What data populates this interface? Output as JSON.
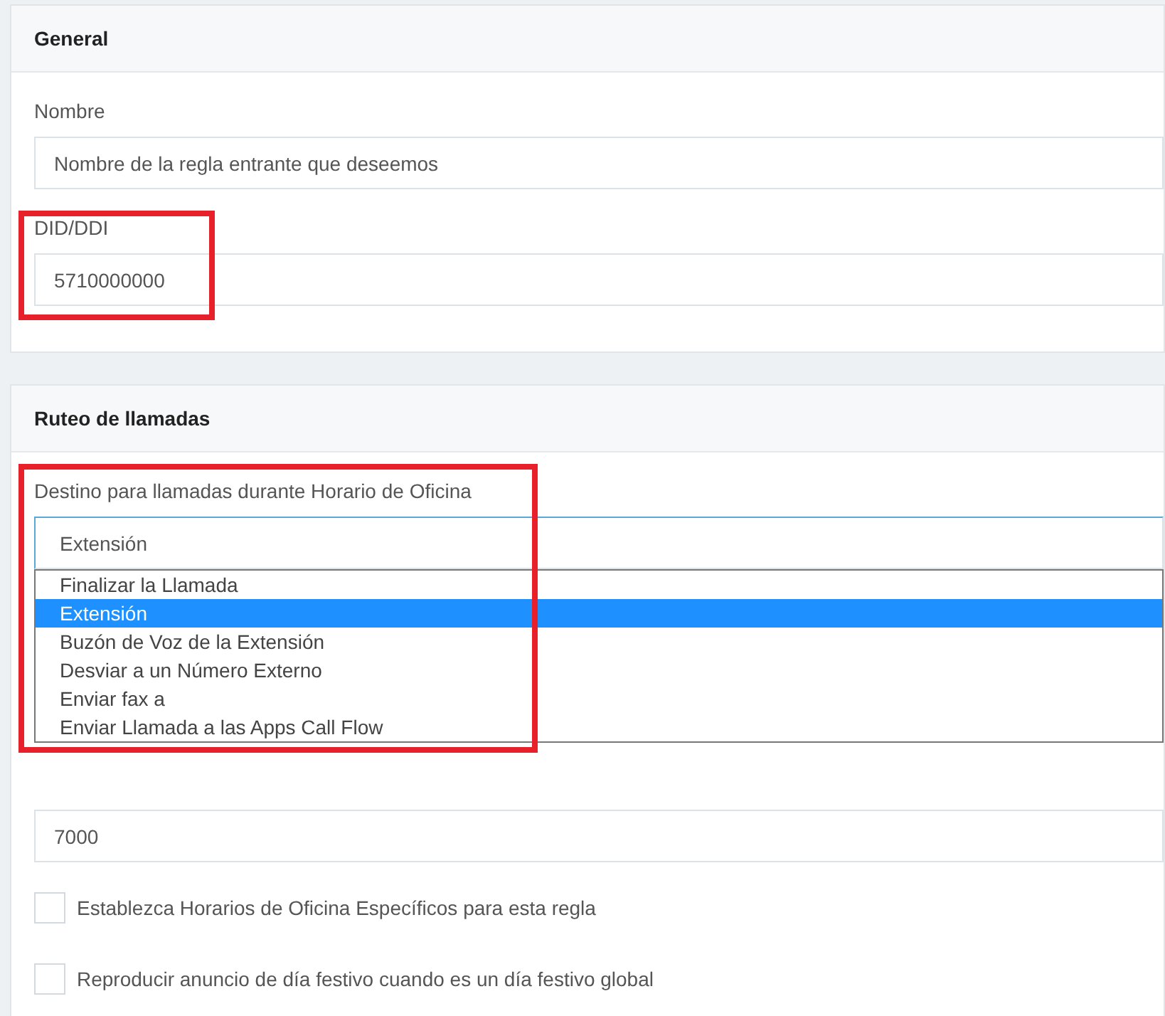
{
  "sections": [
    {
      "title": "General",
      "fields": [
        {
          "kind": "text",
          "label": "Nombre",
          "value": "Nombre de la regla entrante que deseemos",
          "highlighted": false
        },
        {
          "kind": "text",
          "label": "DID/DDI",
          "value": "5710000000",
          "highlighted": true
        }
      ]
    },
    {
      "title": "Ruteo de llamadas",
      "fields": [
        {
          "kind": "select",
          "label": "Destino para llamadas durante Horario de Oficina",
          "value": "Extensión",
          "expanded": true,
          "highlighted": true,
          "options": [
            {
              "label": "Finalizar la Llamada",
              "selected": false
            },
            {
              "label": "Extensión",
              "selected": true
            },
            {
              "label": "Buzón de Voz de la Extensión",
              "selected": false
            },
            {
              "label": "Desviar a un Número Externo",
              "selected": false
            },
            {
              "label": "Enviar fax a",
              "selected": false
            },
            {
              "label": "Enviar Llamada a las Apps Call Flow",
              "selected": false
            }
          ]
        },
        {
          "kind": "text",
          "value": "7000",
          "highlighted": false
        },
        {
          "kind": "checkbox",
          "label": "Establezca Horarios de Oficina Específicos para esta regla",
          "checked": false
        },
        {
          "kind": "checkbox",
          "label": "Reproducir anuncio de día festivo cuando es un día festivo global",
          "checked": false
        }
      ]
    }
  ]
}
